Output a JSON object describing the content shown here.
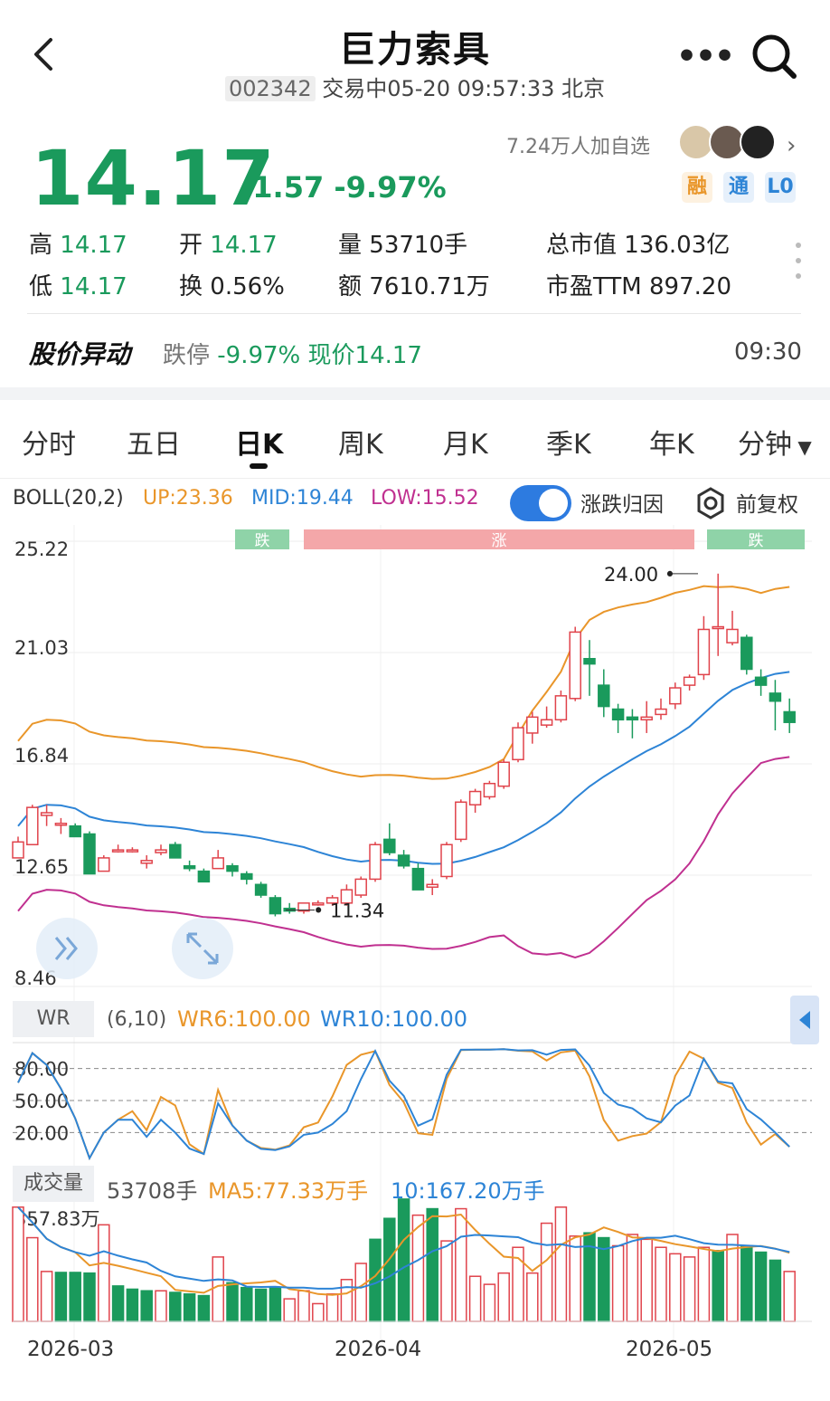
{
  "header": {
    "title": "巨力索具",
    "code": "002342",
    "status": "交易中05-20 09:57:33 北京"
  },
  "quote": {
    "price": "14.17",
    "change": "-1.57 -9.97%",
    "followers": "7.24万人加自选",
    "tags": [
      "融",
      "通",
      "L0"
    ],
    "high_label": "高",
    "high": "14.17",
    "low_label": "低",
    "low": "14.17",
    "open_label": "开",
    "open": "14.17",
    "turnover_label": "换",
    "turnover": "0.56%",
    "volume_label": "量",
    "volume": "53710手",
    "amount_label": "额",
    "amount": "7610.71万",
    "mktcap_label": "总市值",
    "mktcap": "136.03亿",
    "pe_label": "市盈TTM",
    "pe": "897.20"
  },
  "alert": {
    "title": "股价异动",
    "text_label": "跌停",
    "text_value": "-9.97% 现价14.17",
    "time": "09:30"
  },
  "tabs": [
    "分时",
    "五日",
    "日K",
    "周K",
    "月K",
    "季K",
    "年K",
    "分钟"
  ],
  "indicator": {
    "name": "BOLL(20,2)",
    "up": "UP:23.36",
    "mid": "MID:19.44",
    "low": "LOW:15.52",
    "toggle_label": "涨跌归因",
    "adjust_label": "前复权"
  },
  "colors": {
    "up": "#e0434b",
    "down": "#1a9a5c",
    "boll_up": "#e9962a",
    "boll_mid": "#2d84d6",
    "boll_low": "#c03090"
  },
  "chart_data": {
    "type": "candlestick",
    "price_axis_labels": [
      "25.22",
      "21.03",
      "16.84",
      "12.65",
      "8.46"
    ],
    "markers": {
      "high": "24.00",
      "low": "11.34"
    },
    "attribution": [
      "跌",
      "涨",
      "跌"
    ],
    "x_labels": [
      "2026-03",
      "2026-04",
      "2026-05"
    ],
    "candles": [
      [
        13.3,
        14.1,
        13.9,
        13.5
      ],
      [
        13.8,
        15.3,
        15.2,
        14.0
      ],
      [
        14.9,
        15.3,
        15.0,
        14.5
      ],
      [
        14.6,
        14.8,
        14.6,
        14.2
      ],
      [
        14.5,
        14.6,
        14.1,
        14.2
      ],
      [
        14.2,
        14.3,
        12.7,
        12.8
      ],
      [
        12.8,
        13.4,
        13.3,
        12.8
      ],
      [
        13.6,
        13.8,
        13.6,
        13.5
      ],
      [
        13.6,
        13.7,
        13.6,
        13.5
      ],
      [
        13.1,
        13.4,
        13.2,
        12.9
      ],
      [
        13.5,
        13.8,
        13.6,
        13.4
      ],
      [
        13.8,
        13.9,
        13.3,
        13.3
      ],
      [
        13.0,
        13.2,
        12.9,
        12.8
      ],
      [
        12.8,
        12.9,
        12.4,
        12.4
      ],
      [
        12.9,
        13.6,
        13.3,
        12.9
      ],
      [
        13.0,
        13.1,
        12.8,
        12.6
      ],
      [
        12.7,
        12.8,
        12.5,
        12.3
      ],
      [
        12.3,
        12.4,
        11.9,
        11.8
      ],
      [
        11.8,
        11.9,
        11.2,
        11.1
      ],
      [
        11.4,
        11.6,
        11.3,
        11.2
      ],
      [
        11.3,
        11.5,
        11.6,
        11.2
      ],
      [
        11.6,
        11.7,
        11.6,
        11.5
      ],
      [
        11.6,
        11.9,
        11.8,
        11.5
      ],
      [
        11.6,
        12.3,
        12.1,
        11.5
      ],
      [
        11.9,
        12.6,
        12.5,
        11.8
      ],
      [
        12.5,
        13.9,
        13.8,
        12.4
      ],
      [
        14.0,
        14.6,
        13.5,
        13.4
      ],
      [
        13.4,
        13.6,
        13.0,
        12.9
      ],
      [
        12.9,
        13.1,
        12.1,
        12.1
      ],
      [
        12.2,
        12.5,
        12.3,
        11.9
      ],
      [
        12.6,
        13.9,
        13.8,
        12.5
      ],
      [
        14.0,
        15.5,
        15.4,
        13.9
      ],
      [
        15.3,
        15.9,
        15.8,
        15.0
      ],
      [
        15.6,
        16.2,
        16.1,
        15.5
      ],
      [
        16.0,
        17.0,
        16.9,
        15.9
      ],
      [
        17.0,
        18.4,
        18.2,
        16.9
      ],
      [
        18.0,
        18.8,
        18.6,
        17.6
      ],
      [
        18.3,
        19.0,
        18.5,
        18.2
      ],
      [
        18.5,
        19.6,
        19.4,
        18.4
      ],
      [
        19.3,
        22.0,
        21.8,
        19.2
      ],
      [
        20.8,
        21.5,
        20.6,
        19.4
      ],
      [
        19.8,
        20.4,
        19.0,
        18.6
      ],
      [
        18.9,
        19.1,
        18.5,
        18.0
      ],
      [
        18.6,
        18.9,
        18.5,
        17.8
      ],
      [
        18.5,
        19.2,
        18.6,
        18.0
      ],
      [
        18.7,
        19.3,
        18.9,
        18.5
      ],
      [
        19.1,
        19.9,
        19.7,
        18.9
      ],
      [
        19.8,
        20.2,
        20.1,
        19.6
      ],
      [
        20.2,
        22.4,
        21.9,
        20.0
      ],
      [
        22.0,
        24.0,
        22.0,
        20.9
      ],
      [
        21.4,
        22.6,
        21.9,
        21.3
      ],
      [
        21.6,
        21.7,
        20.4,
        20.2
      ],
      [
        20.1,
        20.4,
        19.8,
        19.4
      ],
      [
        19.5,
        20.0,
        19.2,
        18.1
      ],
      [
        18.8,
        19.3,
        18.4,
        18.0
      ]
    ],
    "boll": {
      "up": "23.36",
      "mid": "19.44",
      "low": "15.52"
    },
    "wr": {
      "params": "(6,10)",
      "wr6": "WR6:100.00",
      "wr10": "WR10:100.00",
      "levels": [
        "80.00",
        "50.00",
        "20.00"
      ]
    },
    "volume": {
      "title": "成交量",
      "latest": "53708手",
      "ma5": "MA5:77.33万手",
      "ma10": "10:167.20万手",
      "max_label": "357.83万",
      "bars": [
        3.55,
        2.6,
        1.55,
        1.52,
        1.52,
        1.5,
        3.0,
        1.1,
        1.0,
        0.95,
        0.95,
        0.9,
        0.85,
        0.8,
        2.0,
        1.2,
        1.05,
        1.0,
        1.05,
        0.7,
        0.95,
        0.55,
        0.85,
        1.3,
        1.8,
        2.55,
        3.2,
        3.8,
        3.3,
        3.5,
        2.5,
        3.5,
        1.4,
        1.15,
        1.5,
        2.3,
        1.5,
        3.05,
        3.55,
        2.65,
        2.75,
        2.6,
        2.35,
        2.7,
        2.55,
        2.3,
        2.1,
        2.0,
        2.3,
        2.2,
        2.7,
        2.35,
        2.15,
        1.9,
        1.55
      ],
      "dirs": [
        "u",
        "u",
        "u",
        "d",
        "d",
        "d",
        "u",
        "d",
        "d",
        "d",
        "u",
        "d",
        "d",
        "d",
        "u",
        "d",
        "d",
        "d",
        "d",
        "u",
        "u",
        "u",
        "u",
        "u",
        "u",
        "d",
        "d",
        "d",
        "u",
        "d",
        "u",
        "u",
        "u",
        "u",
        "u",
        "u",
        "u",
        "u",
        "u",
        "u",
        "d",
        "d",
        "u",
        "u",
        "u",
        "u",
        "u",
        "u",
        "u",
        "d",
        "u",
        "d",
        "d",
        "d",
        "u"
      ]
    }
  }
}
